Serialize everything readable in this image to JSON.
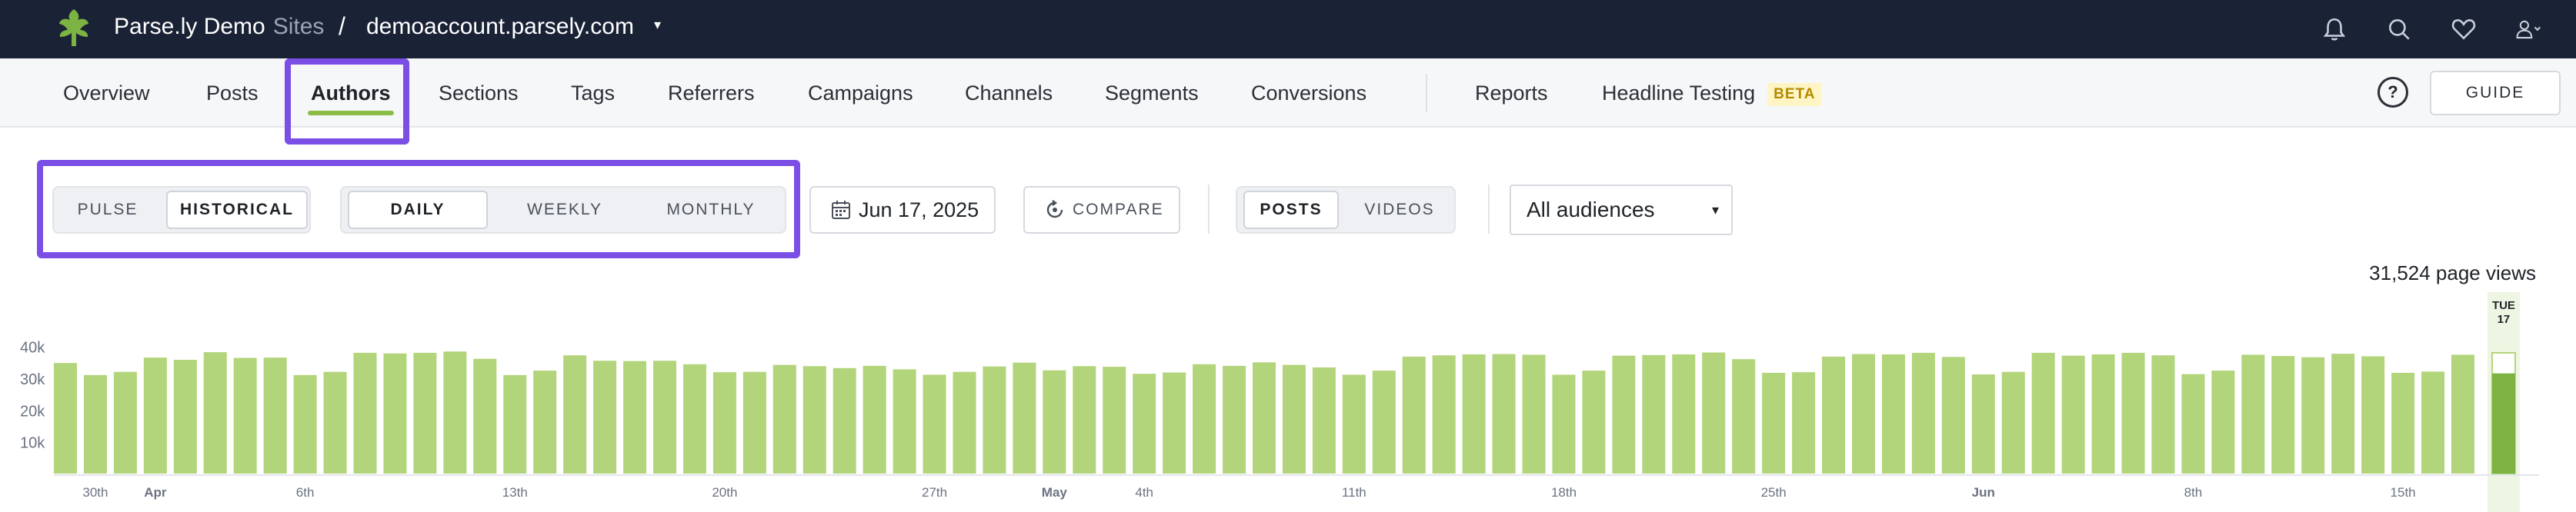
{
  "topbar": {
    "brand": "Parse.ly Demo",
    "sites_label": "Sites",
    "separator": "/",
    "site_name": "demoaccount.parsely.com",
    "caret": "▾",
    "icons": [
      "bell-icon",
      "search-icon",
      "heart-icon",
      "user-icon"
    ]
  },
  "nav": {
    "items": [
      {
        "label": "Overview",
        "active": false
      },
      {
        "label": "Posts",
        "active": false
      },
      {
        "label": "Authors",
        "active": true
      },
      {
        "label": "Sections",
        "active": false
      },
      {
        "label": "Tags",
        "active": false
      },
      {
        "label": "Referrers",
        "active": false
      },
      {
        "label": "Campaigns",
        "active": false
      },
      {
        "label": "Channels",
        "active": false
      },
      {
        "label": "Segments",
        "active": false
      },
      {
        "label": "Conversions",
        "active": false
      },
      {
        "label": "Reports",
        "active": false
      },
      {
        "label": "Headline Testing",
        "active": false
      }
    ],
    "beta_label": "BETA",
    "help_label": "?",
    "guide_label": "GUIDE"
  },
  "controls": {
    "mode": {
      "pulse": "PULSE",
      "historical": "HISTORICAL",
      "selected": "HISTORICAL"
    },
    "period": {
      "daily": "DAILY",
      "weekly": "WEEKLY",
      "monthly": "MONTHLY",
      "selected": "DAILY"
    },
    "date": "Jun 17, 2025",
    "compare": "COMPARE",
    "content": {
      "posts": "POSTS",
      "videos": "VIDEOS",
      "selected": "POSTS"
    },
    "audience": "All audiences",
    "audience_caret": "▾"
  },
  "colors": {
    "topbar_bg": "#1a2336",
    "accent_green": "#8bbd46",
    "bar_green": "#b2d47a",
    "highlight_purple": "#7b4ee6",
    "today_bar": "#7cb342"
  },
  "chart_data": {
    "type": "bar",
    "title": "",
    "total_label": "31,524 page views",
    "y_ticks": [
      "40k",
      "30k",
      "20k",
      "10k"
    ],
    "ylim": [
      0,
      45000
    ],
    "x_labels": [
      {
        "index": 1,
        "text": "30th",
        "bold": false
      },
      {
        "index": 3,
        "text": "Apr",
        "bold": true
      },
      {
        "index": 8,
        "text": "6th",
        "bold": false
      },
      {
        "index": 15,
        "text": "13th",
        "bold": false
      },
      {
        "index": 22,
        "text": "20th",
        "bold": false
      },
      {
        "index": 29,
        "text": "27th",
        "bold": false
      },
      {
        "index": 33,
        "text": "May",
        "bold": true
      },
      {
        "index": 36,
        "text": "4th",
        "bold": false
      },
      {
        "index": 43,
        "text": "11th",
        "bold": false
      },
      {
        "index": 50,
        "text": "18th",
        "bold": false
      },
      {
        "index": 57,
        "text": "25th",
        "bold": false
      },
      {
        "index": 64,
        "text": "Jun",
        "bold": true
      },
      {
        "index": 71,
        "text": "8th",
        "bold": false
      },
      {
        "index": 78,
        "text": "15th",
        "bold": false
      }
    ],
    "today_label": [
      "TUE",
      "17"
    ],
    "today_value": 31524,
    "today_projected": 38000,
    "values": [
      34800,
      31000,
      32000,
      36500,
      35800,
      38200,
      36400,
      36500,
      31000,
      32000,
      38000,
      37800,
      38000,
      38400,
      36100,
      31000,
      32400,
      37200,
      35500,
      35400,
      35500,
      34400,
      31900,
      32000,
      34200,
      33800,
      33200,
      33900,
      32800,
      31100,
      32000,
      33700,
      34900,
      32500,
      33800,
      33600,
      31400,
      31800,
      34400,
      33900,
      35000,
      34200,
      33400,
      31100,
      32400,
      36800,
      37200,
      37500,
      37600,
      37400,
      31100,
      32400,
      37100,
      37300,
      37500,
      38100,
      36000,
      31700,
      31900,
      36800,
      37600,
      37500,
      38000,
      36700,
      31200,
      32000,
      38000,
      37100,
      37500,
      38000,
      37200,
      31300,
      32400,
      37400,
      37000,
      36600,
      37700,
      36900,
      31700,
      32100,
      37400
    ]
  }
}
